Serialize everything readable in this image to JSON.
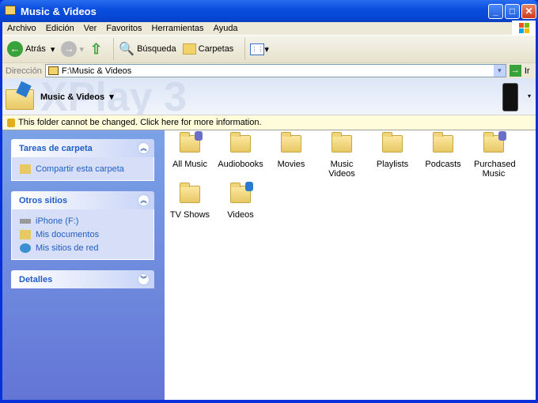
{
  "window": {
    "title": "Music & Videos"
  },
  "menu": [
    "Archivo",
    "Edición",
    "Ver",
    "Favoritos",
    "Herramientas",
    "Ayuda"
  ],
  "toolbar": {
    "back": "Atrás",
    "search": "Búsqueda",
    "folders": "Carpetas"
  },
  "address": {
    "label": "Dirección",
    "value": "F:\\Music & Videos",
    "go": "Ir"
  },
  "banner": {
    "title": "Music & Videos",
    "watermark": "XPlay 3"
  },
  "infobar": "This folder cannot be changed. Click here for more information.",
  "left": {
    "tasks": {
      "title": "Tareas de carpeta",
      "items": [
        "Compartir esta carpeta"
      ]
    },
    "other": {
      "title": "Otros sitios",
      "items": [
        "iPhone (F:)",
        "Mis documentos",
        "Mis sitios de red"
      ]
    },
    "details": {
      "title": "Detalles"
    }
  },
  "folders": [
    "All Music",
    "Audiobooks",
    "Movies",
    "Music Videos",
    "Playlists",
    "Podcasts",
    "Purchased Music",
    "TV Shows",
    "Videos"
  ]
}
